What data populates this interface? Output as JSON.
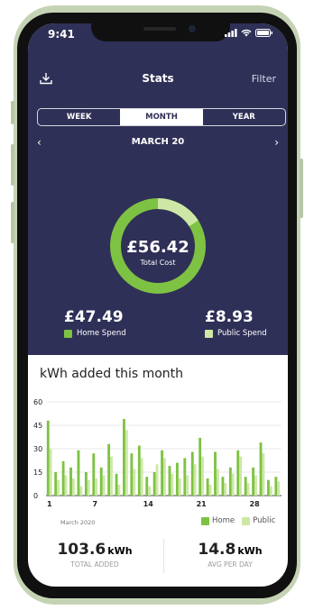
{
  "status_bar": {
    "time": "9:41"
  },
  "header": {
    "title": "Stats",
    "filter_label": "Filter",
    "download_icon": "download-icon"
  },
  "tabs": [
    {
      "label": "WEEK"
    },
    {
      "label": "MONTH"
    },
    {
      "label": "YEAR"
    }
  ],
  "period": {
    "label": "MARCH 20",
    "prev_icon": "chevron-left-icon",
    "next_icon": "chevron-right-icon"
  },
  "summary": {
    "total_amount": "£56.42",
    "total_label": "Total Cost",
    "home_share": 0.84,
    "public_share": 0.16,
    "home_amount": "£47.49",
    "home_label": "Home Spend",
    "public_amount": "£8.93",
    "public_label": "Public Spend"
  },
  "colors": {
    "header_bg": "#2f3057",
    "home": "#7ec243",
    "public": "#cde8a6"
  },
  "kwh_title": "kWh added this month",
  "chart_caption": "March 2020",
  "legend": {
    "home": "Home",
    "public": "Public"
  },
  "chart_data": {
    "type": "bar",
    "title": "kWh added this month",
    "ylim": [
      0,
      60
    ],
    "yticks": [
      "60",
      "45",
      "30",
      "15",
      "0"
    ],
    "xticks": [
      {
        "day": 1,
        "label": "1"
      },
      {
        "day": 7,
        "label": "7"
      },
      {
        "day": 14,
        "label": "14"
      },
      {
        "day": 21,
        "label": "21"
      },
      {
        "day": 28,
        "label": "28"
      }
    ],
    "grid": true,
    "legend_position": "bottom-right",
    "x": [
      1,
      2,
      3,
      4,
      5,
      6,
      7,
      8,
      9,
      10,
      11,
      12,
      13,
      14,
      15,
      16,
      17,
      18,
      19,
      20,
      21,
      22,
      23,
      24,
      25,
      26,
      27,
      28,
      29,
      30,
      31
    ],
    "series": [
      {
        "name": "Home",
        "values": [
          48,
          15,
          22,
          18,
          29,
          15,
          27,
          18,
          33,
          14,
          49,
          27,
          32,
          12,
          15,
          29,
          19,
          21,
          24,
          28,
          37,
          11,
          28,
          12,
          18,
          29,
          12,
          18,
          34,
          10,
          12
        ]
      },
      {
        "name": "Public",
        "values": [
          30,
          10,
          13,
          11,
          6,
          10,
          11,
          13,
          25,
          7,
          42,
          17,
          24,
          6,
          20,
          24,
          14,
          11,
          13,
          20,
          25,
          7,
          17,
          8,
          14,
          25,
          8,
          13,
          27,
          6,
          9
        ]
      }
    ]
  },
  "footer": {
    "total_value": "103.6",
    "total_unit": "kWh",
    "total_caption": "TOTAL ADDED",
    "avg_value": "14.8",
    "avg_unit": "kWh",
    "avg_caption": "AVG PER DAY"
  }
}
